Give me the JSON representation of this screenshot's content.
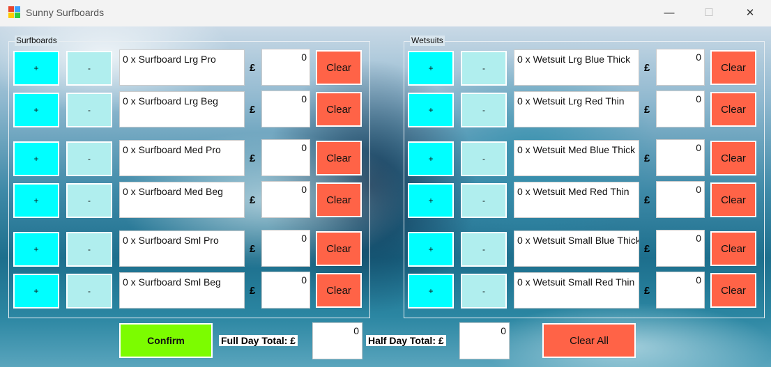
{
  "window": {
    "title": "Sunny Surfboards",
    "minimize": "—",
    "maximize": "☐",
    "close": "✕"
  },
  "icons": {
    "app": "app-icon",
    "colors": [
      "#e8452c",
      "#3aa0ff",
      "#ffcc00",
      "#2ecc40"
    ]
  },
  "surfboards": {
    "label": "Surfboards",
    "rows": [
      {
        "plus": "+",
        "minus": "-",
        "desc": "0 x Surfboard Lrg Pro",
        "currency": "£",
        "amount": "0",
        "clear": "Clear"
      },
      {
        "plus": "+",
        "minus": "-",
        "desc": "0 x Surfboard Lrg Beg",
        "currency": "£",
        "amount": "0",
        "clear": "Clear"
      },
      {
        "plus": "+",
        "minus": "-",
        "desc": "0 x Surfboard Med Pro",
        "currency": "£",
        "amount": "0",
        "clear": "Clear"
      },
      {
        "plus": "+",
        "minus": "-",
        "desc": "0 x Surfboard Med Beg",
        "currency": "£",
        "amount": "0",
        "clear": "Clear"
      },
      {
        "plus": "+",
        "minus": "-",
        "desc": "0 x Surfboard Sml Pro",
        "currency": "£",
        "amount": "0",
        "clear": "Clear"
      },
      {
        "plus": "+",
        "minus": "-",
        "desc": "0 x Surfboard Sml Beg",
        "currency": "£",
        "amount": "0",
        "clear": "Clear"
      }
    ]
  },
  "wetsuits": {
    "label": "Wetsuits",
    "rows": [
      {
        "plus": "+",
        "minus": "-",
        "desc": "0 x Wetsuit Lrg Blue Thick",
        "currency": "£",
        "amount": "0",
        "clear": "Clear"
      },
      {
        "plus": "+",
        "minus": "-",
        "desc": "0 x Wetsuit Lrg Red Thin",
        "currency": "£",
        "amount": "0",
        "clear": "Clear"
      },
      {
        "plus": "+",
        "minus": "-",
        "desc": "0 x Wetsuit Med Blue Thick",
        "currency": "£",
        "amount": "0",
        "clear": "Clear"
      },
      {
        "plus": "+",
        "minus": "-",
        "desc": "0 x Wetsuit Med Red Thin",
        "currency": "£",
        "amount": "0",
        "clear": "Clear"
      },
      {
        "plus": "+",
        "minus": "-",
        "desc": "0 x Wetsuit Small Blue Thick",
        "currency": "£",
        "amount": "0",
        "clear": "Clear"
      },
      {
        "plus": "+",
        "minus": "-",
        "desc": "0 x Wetsuit Small Red Thin",
        "currency": "£",
        "amount": "0",
        "clear": "Clear"
      }
    ]
  },
  "footer": {
    "confirm": "Confirm",
    "full_day_label": "Full Day Total: £",
    "full_day_value": "0",
    "half_day_label": "Half Day Total: £",
    "half_day_value": "0",
    "clear_all": "Clear All"
  },
  "colors": {
    "plus": "#00ffff",
    "minus": "#b0eeee",
    "clear": "#ff6347",
    "confirm": "#7cfc00"
  }
}
